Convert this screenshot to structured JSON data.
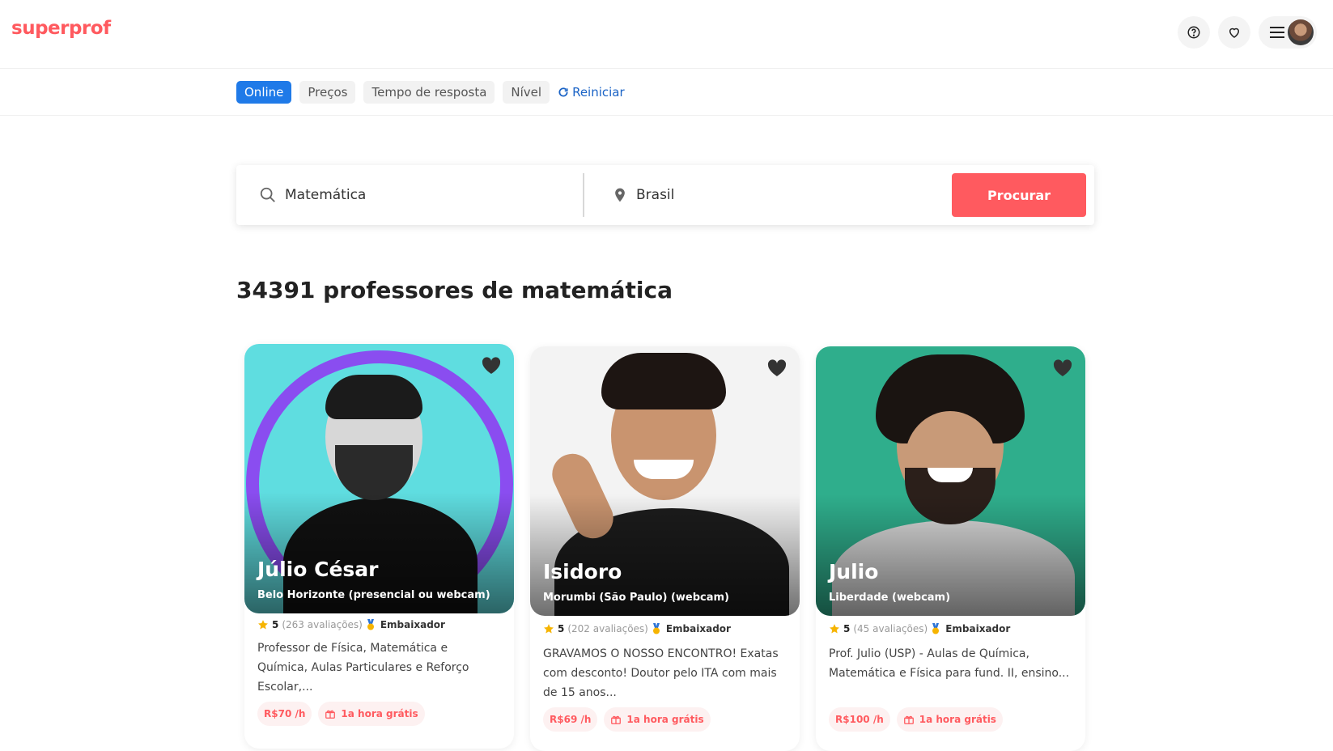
{
  "header": {
    "logo": "superprof",
    "help_icon": "help-circle-icon",
    "favorites_icon": "heart-outline-icon",
    "menu_icon": "hamburger-icon"
  },
  "filters": {
    "items": [
      "Online",
      "Preços",
      "Tempo de resposta",
      "Nível"
    ],
    "active": "Online",
    "reset_label": "Reiniciar"
  },
  "search": {
    "subject_value": "Matemática",
    "location_value": "Brasil",
    "button_label": "Procurar"
  },
  "results": {
    "heading": "34391 professores de matemática"
  },
  "teachers": [
    {
      "name": "Júlio César",
      "location": "Belo Horizonte (presencial ou webcam)",
      "rating": "5",
      "reviews": "(263 avaliações)",
      "badge": "Embaixador",
      "description": "Professor de Física, Matemática e Química, Aulas Particulares e Reforço Escolar,...",
      "price": "R$70 /h",
      "offer": "1a hora grátis"
    },
    {
      "name": "Isidoro",
      "location": "Morumbi (São Paulo) (webcam)",
      "rating": "5",
      "reviews": "(202 avaliações)",
      "badge": "Embaixador",
      "description": "GRAVAMOS O NOSSO ENCONTRO! Exatas com desconto! Doutor pelo ITA com mais de 15 anos...",
      "price": "R$69 /h",
      "offer": "1a hora grátis"
    },
    {
      "name": "Julio",
      "location": "Liberdade (webcam)",
      "rating": "5",
      "reviews": "(45 avaliações)",
      "badge": "Embaixador",
      "description": "Prof. Julio (USP) - Aulas de Química, Matemática e Física para fund. II, ensino...",
      "price": "R$100 /h",
      "offer": "1a hora grátis"
    }
  ],
  "colors": {
    "brand": "#ff5a5f",
    "active_chip": "#1f7ae8",
    "link": "#1a63c6"
  }
}
